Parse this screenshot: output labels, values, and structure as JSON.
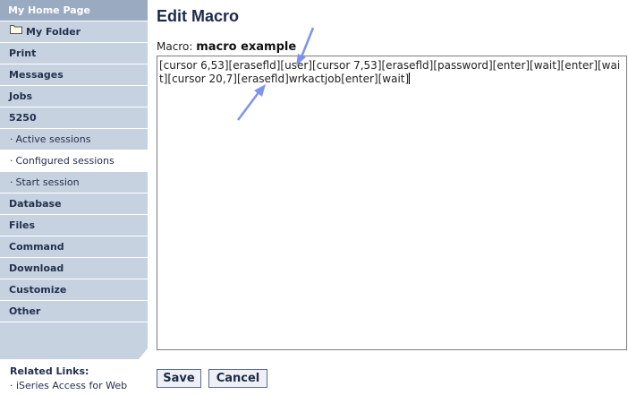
{
  "sidebar": {
    "items": [
      {
        "label": "My Home Page"
      },
      {
        "label": "My Folder"
      },
      {
        "label": "Print"
      },
      {
        "label": "Messages"
      },
      {
        "label": "Jobs"
      },
      {
        "label": "5250"
      },
      {
        "label": "Active sessions"
      },
      {
        "label": "Configured sessions"
      },
      {
        "label": "Start session"
      },
      {
        "label": "Database"
      },
      {
        "label": "Files"
      },
      {
        "label": "Command"
      },
      {
        "label": "Download"
      },
      {
        "label": "Customize"
      },
      {
        "label": "Other"
      }
    ],
    "sub_bullet": "·"
  },
  "related_links": {
    "title": "Related Links:",
    "links": [
      {
        "label": "iSeries Access for Web"
      }
    ]
  },
  "main": {
    "title": "Edit Macro",
    "macro_label": "Macro:",
    "macro_name": "macro example",
    "macro_text": "[cursor 6,53][erasefld][user][cursor 7,53][erasefld][password][enter][wait][enter][wait][cursor 20,7][erasefld]wrkactjob[enter][wait]"
  },
  "buttons": {
    "save": "Save",
    "cancel": "Cancel"
  },
  "colors": {
    "nav_bg": "#c7d2e0",
    "nav_home_bg": "#99aac1",
    "arrow": "#7f93ec"
  }
}
